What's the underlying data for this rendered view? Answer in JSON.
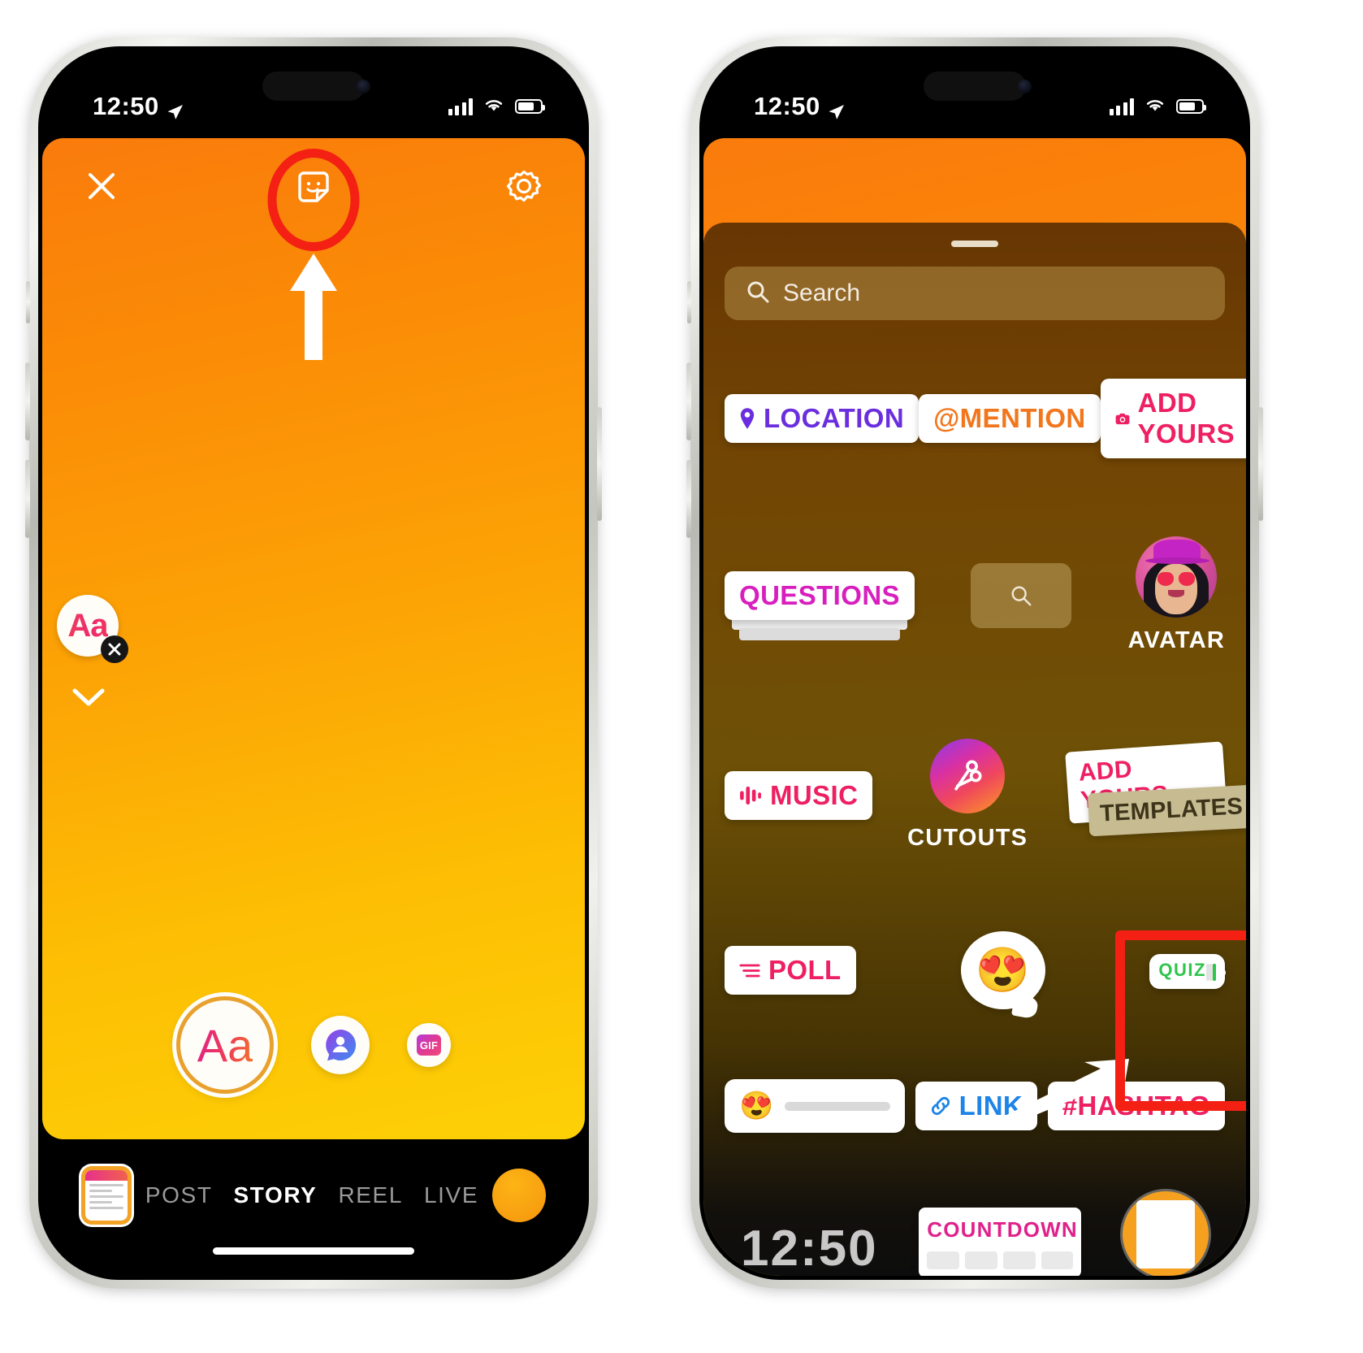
{
  "status_bar": {
    "time": "12:50",
    "location_icon": "location-arrow-icon",
    "signal_icon": "cellular-bars-icon",
    "wifi_icon": "wifi-icon",
    "battery_icon": "battery-icon"
  },
  "left_phone": {
    "screen_name": "instagram-story-composer",
    "top_bar": {
      "close_label": "close-icon",
      "sticker_label": "sticker-icon",
      "settings_label": "settings-gear-icon"
    },
    "annotations": {
      "highlight_circle_color": "#f32013",
      "arrow_color": "#ffffff",
      "arrow_direction": "up",
      "highlight_target": "sticker-icon"
    },
    "floating_text_tool": {
      "label": "Aa",
      "delete_badge": "×"
    },
    "chevron_label": "chevron-down-icon",
    "tools": [
      {
        "name": "text-tool",
        "label": "Aa"
      },
      {
        "name": "sticker-tool",
        "label": "sticker-person-icon"
      },
      {
        "name": "gif-tool",
        "label": "GIF"
      }
    ],
    "bottom_bar": {
      "gallery_label": "gallery-thumbnail",
      "modes": [
        {
          "label": "POST",
          "active": false
        },
        {
          "label": "STORY",
          "active": true
        },
        {
          "label": "REEL",
          "active": false
        },
        {
          "label": "LIVE",
          "active": false
        }
      ],
      "capture_label": "capture-button"
    }
  },
  "right_phone": {
    "screen_name": "instagram-sticker-tray",
    "search": {
      "placeholder": "Search",
      "icon": "search-icon"
    },
    "stickers": {
      "row1": [
        {
          "label": "LOCATION",
          "icon": "location-pin-icon",
          "color": "#6a2ede"
        },
        {
          "label": "@MENTION",
          "icon": "mention-at-icon",
          "color": "#f2761c"
        },
        {
          "label": "ADD YOURS",
          "icon": "camera-icon",
          "color": "#ee1f62"
        }
      ],
      "row2": [
        {
          "label": "QUESTIONS",
          "color": "#d81fbe"
        },
        {
          "label": "",
          "icon": "search-icon"
        },
        {
          "label": "AVATAR"
        }
      ],
      "row3": [
        {
          "label": "MUSIC",
          "icon": "music-waveform-icon",
          "color": "#ee1f62"
        },
        {
          "label": "CUTOUTS",
          "icon": "scissors-icon"
        },
        {
          "label": "ADD YOURS",
          "label2": "TEMPLATES"
        }
      ],
      "row4": [
        {
          "label": "POLL",
          "icon": "poll-icon",
          "color": "#ee1f62"
        },
        {
          "label": "emoji-reaction-sticker",
          "emoji": "😍"
        },
        {
          "label": "QUIZ",
          "color": "#2fc44c",
          "highlighted": true
        }
      ],
      "row5": [
        {
          "label": "emoji-slider-sticker",
          "emoji": "😍"
        },
        {
          "label": "LINK",
          "icon": "link-icon",
          "color": "#1d84e8"
        },
        {
          "label": "#HASHTAG",
          "color": "#ee1f62"
        }
      ],
      "row6": [
        {
          "label": "12:50"
        },
        {
          "label": "COUNTDOWN",
          "color": "#e0218a"
        },
        {
          "label": "media-thumbnail"
        }
      ]
    },
    "annotations": {
      "highlight_box_color": "#f32013",
      "arrow_color": "#ffffff",
      "highlight_target": "QUIZ"
    }
  }
}
